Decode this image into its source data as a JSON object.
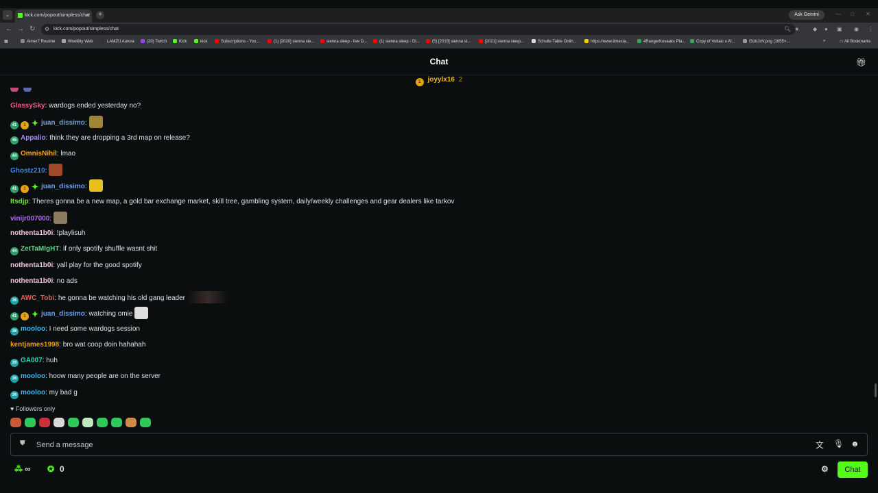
{
  "browser": {
    "tab_title": "kick.com/popout/simpless/chat",
    "url": "kick.com/popout/simpless/chat",
    "ask_gemini": "Ask Gemini",
    "all_bookmarks": "All Bookmarks",
    "bookmarks": [
      {
        "label": "Aimer7 Routine",
        "color": "#888888"
      },
      {
        "label": "Wootility Web",
        "color": "#aaaaaa"
      },
      {
        "label": "LAMZU Aurora",
        "color": "#333333"
      },
      {
        "label": "(20) Twitch",
        "color": "#9146ff"
      },
      {
        "label": "Kick",
        "color": "#53fc18"
      },
      {
        "label": "kick",
        "color": "#53fc18"
      },
      {
        "label": "Subscriptions - You...",
        "color": "#ff0000"
      },
      {
        "label": "(1) [2020] sienna sle...",
        "color": "#ff0000"
      },
      {
        "label": "sienna sleep - live D...",
        "color": "#ff0000"
      },
      {
        "label": "(1) sienna sleep - Di...",
        "color": "#ff0000"
      },
      {
        "label": "(5) [2019] sienna sl...",
        "color": "#ff0000"
      },
      {
        "label": "[2021] sienna sleep...",
        "color": "#ff0000"
      },
      {
        "label": "Schulte Table Onlin...",
        "color": "#dddddd"
      },
      {
        "label": "https://www.timesta...",
        "color": "#f5d000"
      },
      {
        "label": "4RangerKovaaks Pla...",
        "color": "#34a853"
      },
      {
        "label": "Copy of Voltaic x AI...",
        "color": "#34a853"
      },
      {
        "label": "GlzbJoV.png (1655×...",
        "color": "#999999"
      }
    ]
  },
  "chat": {
    "title": "Chat",
    "pinned": {
      "user": "joyylx16",
      "count": "2"
    },
    "messages": [
      {
        "user": "GlassySky",
        "color": "#ef5b8a",
        "badges": [],
        "text": ": wardogs ended yesterday no?",
        "emote": null
      },
      {
        "user": "juan_dissimo",
        "color": "#6f9fe6",
        "badges": [
          "41",
          "coin",
          "star"
        ],
        "text": ":",
        "emote": "#a0843a"
      },
      {
        "user": "Appalio",
        "color": "#a78bfa",
        "badges": [
          "45"
        ],
        "text": ": think they are dropping a 3rd map on release?",
        "emote": null
      },
      {
        "user": "OmnisNihil",
        "color": "#f5a524",
        "badges": [
          "44"
        ],
        "text": ": lmao",
        "emote": null
      },
      {
        "user": "Ghostz210",
        "color": "#3b82f6",
        "badges": [],
        "text": ":",
        "emote": "#a04a2a"
      },
      {
        "user": "juan_dissimo",
        "color": "#6f9fe6",
        "badges": [
          "41",
          "coin",
          "star"
        ],
        "text": ":",
        "emote": "#e8c020"
      },
      {
        "user": "Itsdjp",
        "color": "#7ee04a",
        "badges": [],
        "text": ": Theres gonna be a new map, a gold bar exchange market, skill tree, gambling system, daily/weekly challenges and gear dealers like tarkov",
        "emote": null
      },
      {
        "user": "vinijr007000",
        "color": "#b366ff",
        "badges": [],
        "text": ":",
        "emote": "#8a7a60"
      },
      {
        "user": "nothenta1b0i",
        "color": "#f0c6d8",
        "badges": [],
        "text": ": !playlisuh",
        "emote": null
      },
      {
        "user": "ZetTaMIgHT",
        "color": "#53d88a",
        "badges": [
          "44"
        ],
        "text": ": if only spotify shuffle wasnt shit",
        "emote": null
      },
      {
        "user": "nothenta1b0i",
        "color": "#f0c6d8",
        "badges": [],
        "text": ": yall play for the good spotify",
        "emote": null
      },
      {
        "user": "nothenta1b0i",
        "color": "#f0c6d8",
        "badges": [],
        "text": ": no ads",
        "emote": null
      },
      {
        "user": "AWC_Tobi",
        "color": "#ef5b5b",
        "badges": [
          "36"
        ],
        "text": ": he gonna be watching his old gang leader",
        "emote": "#3a2a2a"
      },
      {
        "user": "juan_dissimo",
        "color": "#6f9fe6",
        "badges": [
          "41",
          "coin",
          "star"
        ],
        "text": ": watching omie",
        "emote": "#dddddd"
      },
      {
        "user": "mooloo",
        "color": "#38bdf8",
        "badges": [
          "36"
        ],
        "text": ": I need some wardogs session",
        "emote": null
      },
      {
        "user": "kentjames1998",
        "color": "#f59e0b",
        "badges": [],
        "text": ": bro wat coop doin hahahah",
        "emote": null
      },
      {
        "user": "GA007",
        "color": "#2dd4bf",
        "badges": [
          "39"
        ],
        "text": ": huh",
        "emote": null
      },
      {
        "user": "mooloo",
        "color": "#38bdf8",
        "badges": [
          "36"
        ],
        "text": ": hoow many people are on the server",
        "emote": null
      },
      {
        "user": "mooloo",
        "color": "#38bdf8",
        "badges": [
          "36"
        ],
        "text": ": my bad g",
        "emote": null
      }
    ],
    "followers_only": "Followers only",
    "input_placeholder": "Send a message",
    "footer": {
      "points": "∞",
      "count": "0",
      "chat_button": "Chat"
    }
  }
}
